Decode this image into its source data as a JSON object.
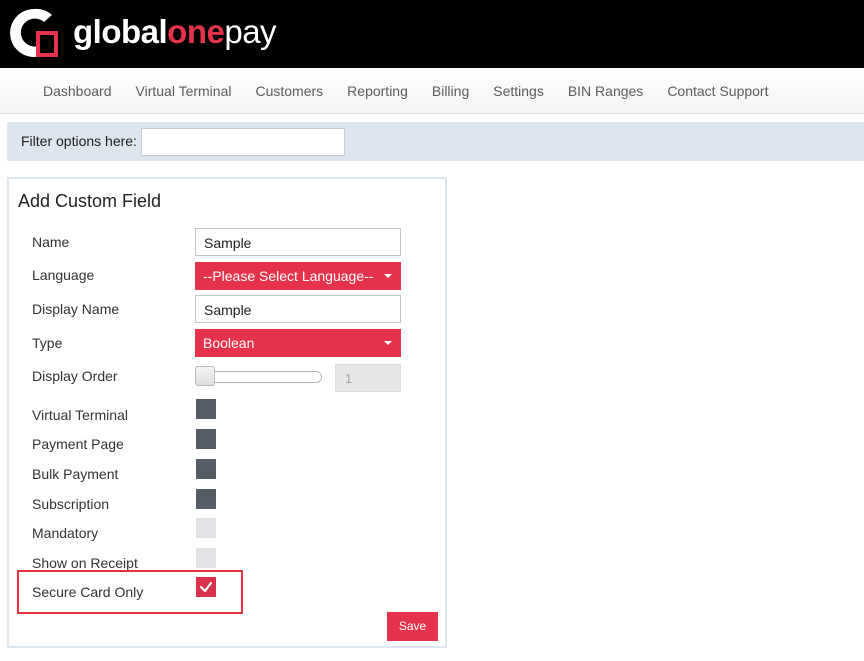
{
  "header": {
    "logo_part1": "global",
    "logo_part2": "one",
    "logo_part3": "pay",
    "colors": {
      "background": "#000000",
      "accent": "#e6324b"
    }
  },
  "nav": {
    "items": [
      "Dashboard",
      "Virtual Terminal",
      "Customers",
      "Reporting",
      "Billing",
      "Settings",
      "BIN Ranges",
      "Contact Support"
    ]
  },
  "filter": {
    "label": "Filter options here:",
    "value": ""
  },
  "form": {
    "title": "Add Custom Field",
    "name_label": "Name",
    "name_value": "Sample",
    "language_label": "Language",
    "language_selected": "--Please Select Language--",
    "display_name_label": "Display Name",
    "display_name_value": "Sample",
    "type_label": "Type",
    "type_selected": "Boolean",
    "display_order_label": "Display Order",
    "display_order_value": "1",
    "checkboxes": [
      {
        "label": "Virtual Terminal",
        "state": "dark"
      },
      {
        "label": "Payment Page",
        "state": "dark"
      },
      {
        "label": "Bulk Payment",
        "state": "dark"
      },
      {
        "label": "Subscription",
        "state": "dark"
      },
      {
        "label": "Mandatory",
        "state": "light"
      },
      {
        "label": "Show on Receipt",
        "state": "light"
      },
      {
        "label": "Secure Card Only",
        "state": "checked"
      }
    ],
    "save_label": "Save"
  },
  "colors": {
    "accent": "#e6324b",
    "checkbox_dark": "#555c65",
    "checkbox_light": "#e2e3e6",
    "highlight": "#e3333f",
    "filter_bg": "#dde5ee"
  }
}
